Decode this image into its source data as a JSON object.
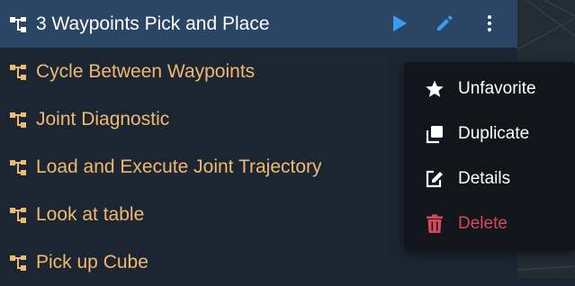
{
  "objectives": [
    {
      "label": "3 Waypoints Pick and Place",
      "icon": "objective-tree-icon",
      "selected": true
    },
    {
      "label": "Cycle Between Waypoints",
      "icon": "objective-tree-icon",
      "selected": false
    },
    {
      "label": "Joint Diagnostic",
      "icon": "objective-tree-icon",
      "selected": false
    },
    {
      "label": "Load and Execute Joint Trajectory",
      "icon": "objective-tree-icon",
      "selected": false
    },
    {
      "label": "Look at table",
      "icon": "objective-tree-icon",
      "selected": false
    },
    {
      "label": "Pick up Cube",
      "icon": "objective-tree-icon",
      "selected": false
    }
  ],
  "row_actions": {
    "run_icon": "play-icon",
    "edit_icon": "pencil-icon",
    "more_icon": "more-vertical-icon"
  },
  "context_menu": {
    "items": [
      {
        "label": "Unfavorite",
        "icon": "star-icon"
      },
      {
        "label": "Duplicate",
        "icon": "duplicate-icon"
      },
      {
        "label": "Details",
        "icon": "edit-note-icon"
      },
      {
        "label": "Delete",
        "icon": "trash-icon"
      }
    ]
  },
  "colors": {
    "panel_bg": "#1c2633",
    "selected_row_bg": "#2b4565",
    "objective_text": "#f1b86e",
    "selected_text": "#ffffff",
    "accent_blue": "#3a9bf0",
    "menu_bg": "#12161c",
    "delete_red": "#d9475b"
  }
}
